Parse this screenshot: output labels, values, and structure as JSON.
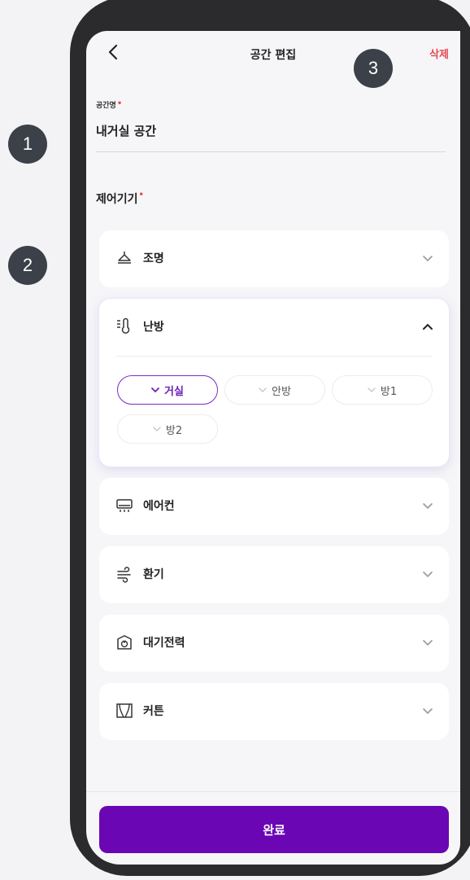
{
  "header": {
    "title": "공간 편집",
    "delete_label": "삭제"
  },
  "space": {
    "label": "공간명",
    "value": "내거실 공간"
  },
  "devices_label": "제어기기",
  "devices": [
    {
      "name": "조명",
      "icon": "ceiling-lamp-icon",
      "expanded": false
    },
    {
      "name": "난방",
      "icon": "thermometer-icon",
      "expanded": true,
      "rooms": [
        {
          "label": "거실",
          "selected": true
        },
        {
          "label": "안방",
          "selected": false
        },
        {
          "label": "방1",
          "selected": false
        },
        {
          "label": "방2",
          "selected": false
        }
      ]
    },
    {
      "name": "에어컨",
      "icon": "air-conditioner-icon",
      "expanded": false
    },
    {
      "name": "환기",
      "icon": "wind-icon",
      "expanded": false
    },
    {
      "name": "대기전력",
      "icon": "power-outlet-icon",
      "expanded": false
    },
    {
      "name": "커튼",
      "icon": "curtain-icon",
      "expanded": false
    }
  ],
  "done_label": "완료",
  "badges": [
    "1",
    "2",
    "3"
  ],
  "colors": {
    "accent": "#6a06b3",
    "required": "#e64a52",
    "badge": "#3c4048"
  }
}
